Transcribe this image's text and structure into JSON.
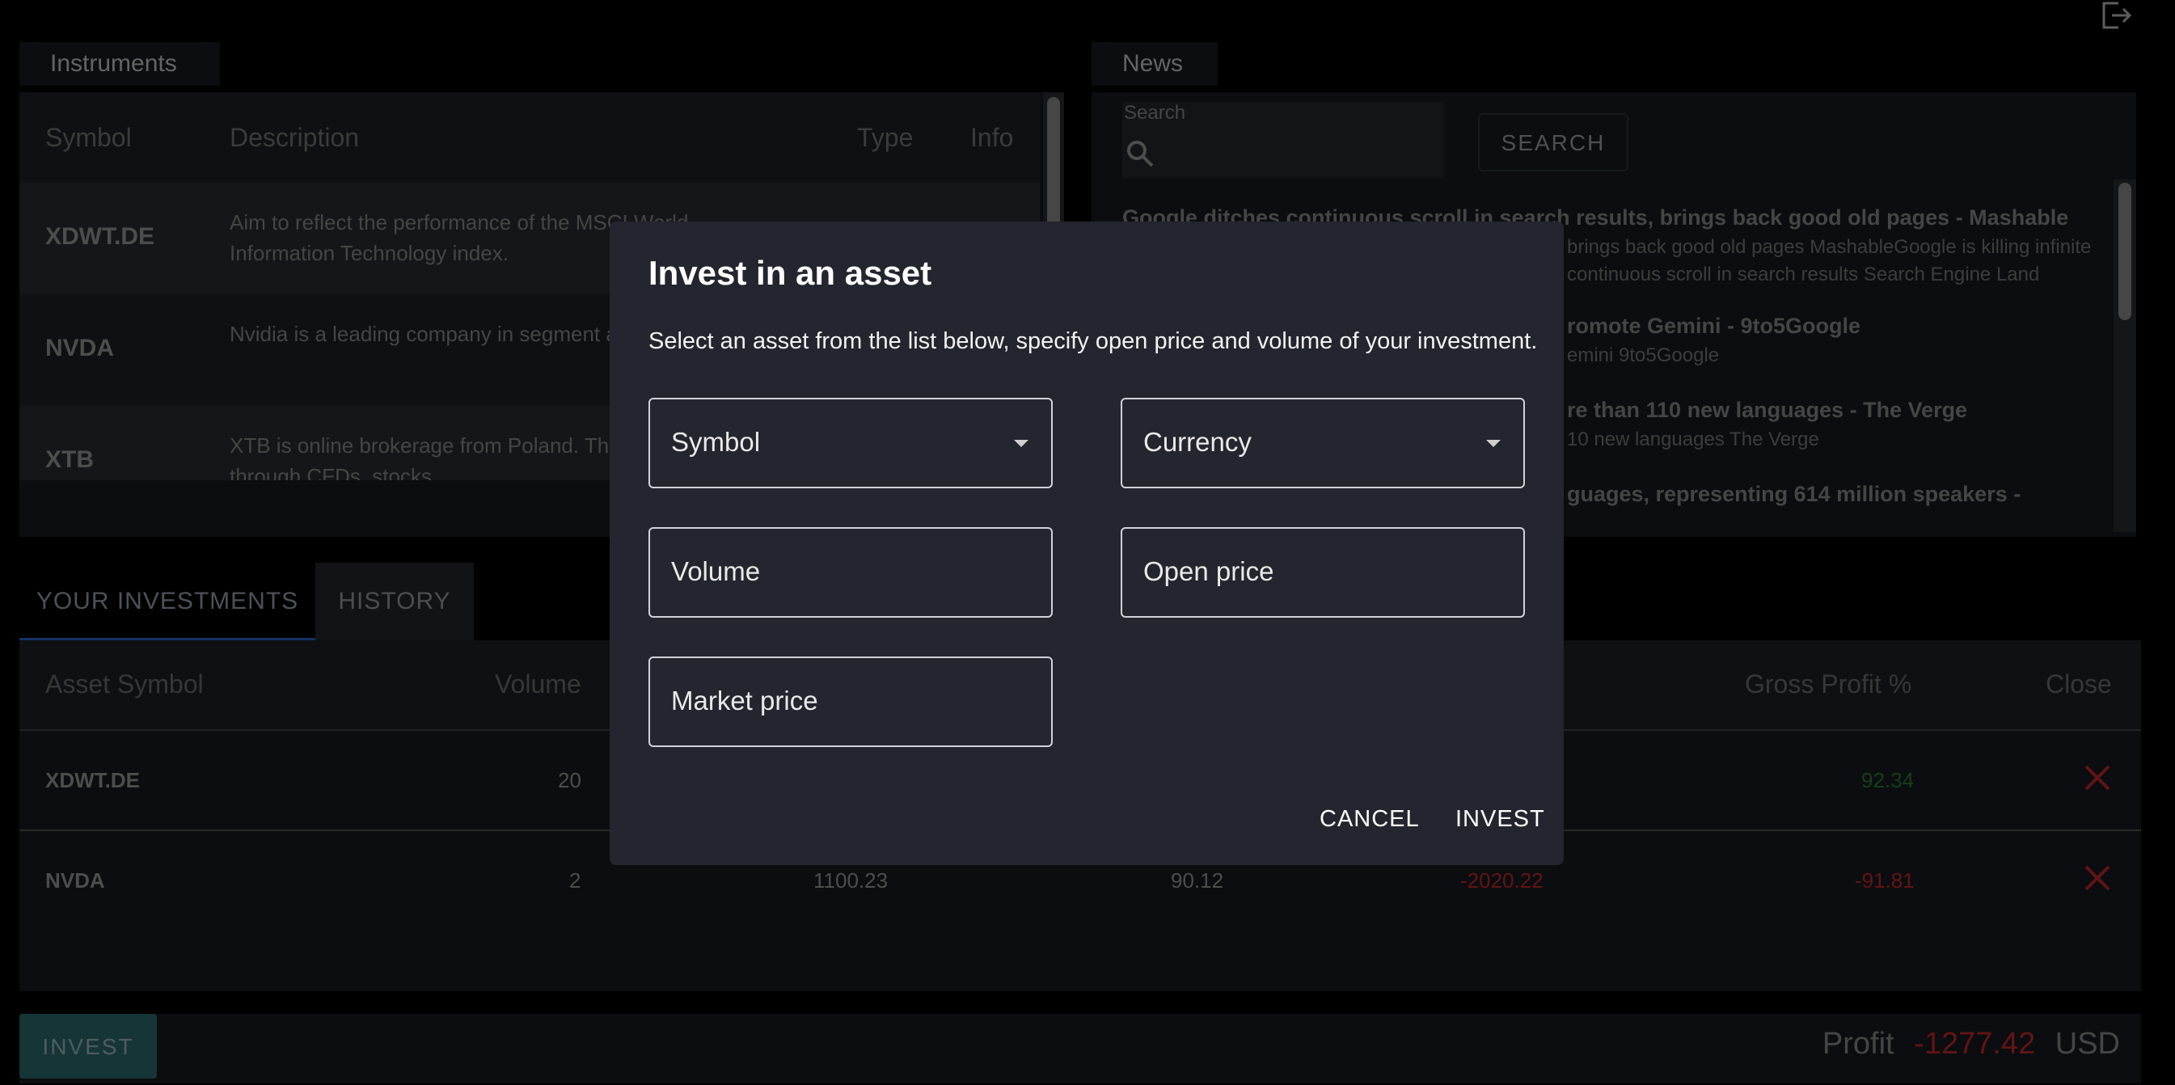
{
  "instruments": {
    "tab_label": "Instruments",
    "columns": [
      "Symbol",
      "Description",
      "Type",
      "Info"
    ],
    "rows": [
      {
        "symbol": "XDWT.DE",
        "description": "Aim to reflect the performance of the MSCI World Information Technology index."
      },
      {
        "symbol": "NVDA",
        "description": "Nvidia is a leading company in segment accelerators"
      },
      {
        "symbol": "XTB",
        "description": "XTB is online brokerage from Poland. Th various markets through CFDs, stocks,"
      }
    ]
  },
  "news": {
    "tab_label": "News",
    "search_label": "Search",
    "search_button": "SEARCH",
    "items": [
      {
        "title": "Google ditches continuous scroll in search results, brings back good old pages - Mashable",
        "snippet": "brings back good old pages MashableGoogle is killing infinite continuous scroll in search results Search Engine Land"
      },
      {
        "title": "romote Gemini - 9to5Google",
        "snippet": "emini 9to5Google"
      },
      {
        "title": "re than 110 new languages - The Verge",
        "snippet": "10 new languages The Verge"
      },
      {
        "title": "guages, representing 614 million speakers -",
        "snippet": ""
      }
    ]
  },
  "investments": {
    "tabs": [
      "YOUR INVESTMENTS",
      "HISTORY"
    ],
    "columns": {
      "asset_symbol": "Asset Symbol",
      "volume": "Volume",
      "gross_profit_pct": "Gross Profit %",
      "close": "Close"
    },
    "rows": [
      {
        "symbol": "XDWT.DE",
        "volume": "20",
        "open_price": "",
        "market_price": "",
        "gross_profit": "",
        "gross_profit_pct": "92.34"
      },
      {
        "symbol": "NVDA",
        "volume": "2",
        "open_price": "1100.23",
        "market_price": "90.12",
        "gross_profit": "-2020.22",
        "gross_profit_pct": "-91.81"
      }
    ]
  },
  "bottom": {
    "invest_button": "INVEST",
    "profit_label": "Profit",
    "profit_value": "-1277.42",
    "currency": "USD"
  },
  "modal": {
    "title": "Invest in an asset",
    "description": "Select an asset from the list below, specify open price and volume of your investment.",
    "symbol_label": "Symbol",
    "currency_label": "Currency",
    "volume_label": "Volume",
    "open_price_label": "Open price",
    "market_price_label": "Market price",
    "cancel": "CANCEL",
    "invest": "INVEST"
  },
  "colors": {
    "positive": "#2e7d32",
    "negative": "#c62828",
    "accent": "#1976d2"
  }
}
